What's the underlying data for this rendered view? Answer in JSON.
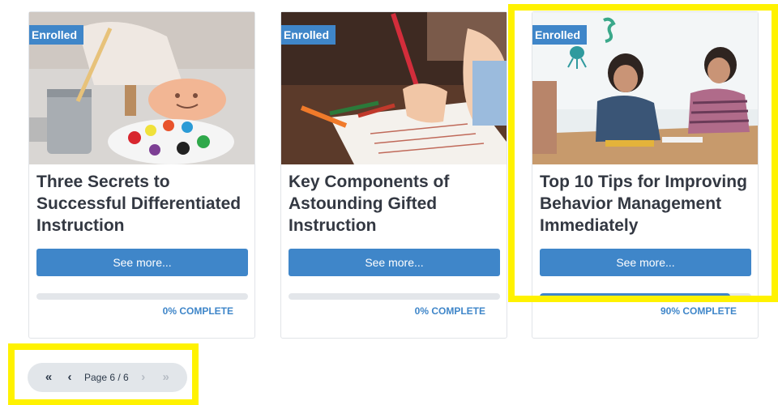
{
  "colors": {
    "accent": "#3f86c9",
    "highlight": "#fff200",
    "title_text": "#333842"
  },
  "cards": [
    {
      "badge": "Enrolled",
      "image_icon": "painting-supplies-photo",
      "title": "Three Secrets to Successful Differentiated Instruction",
      "button_label": "See more...",
      "progress": 0,
      "complete_label": "0% COMPLETE"
    },
    {
      "badge": "Enrolled",
      "image_icon": "child-writing-photo",
      "title": "Key Components of Astounding Gifted Instruction",
      "button_label": "See more...",
      "progress": 0,
      "complete_label": "0% COMPLETE"
    },
    {
      "badge": "Enrolled",
      "image_icon": "students-drawing-photo",
      "title": "Top 10 Tips for Improving Behavior Management Immediately",
      "button_label": "See more...",
      "progress": 90,
      "complete_label": "90% COMPLETE"
    }
  ],
  "pager": {
    "first_icon": "double-chevron-left-icon",
    "first_glyph": "«",
    "prev_icon": "chevron-left-icon",
    "prev_glyph": "‹",
    "page_label": "Page 6 / 6",
    "next_icon": "chevron-right-icon",
    "next_glyph": "›",
    "last_icon": "double-chevron-right-icon",
    "last_glyph": "»"
  }
}
